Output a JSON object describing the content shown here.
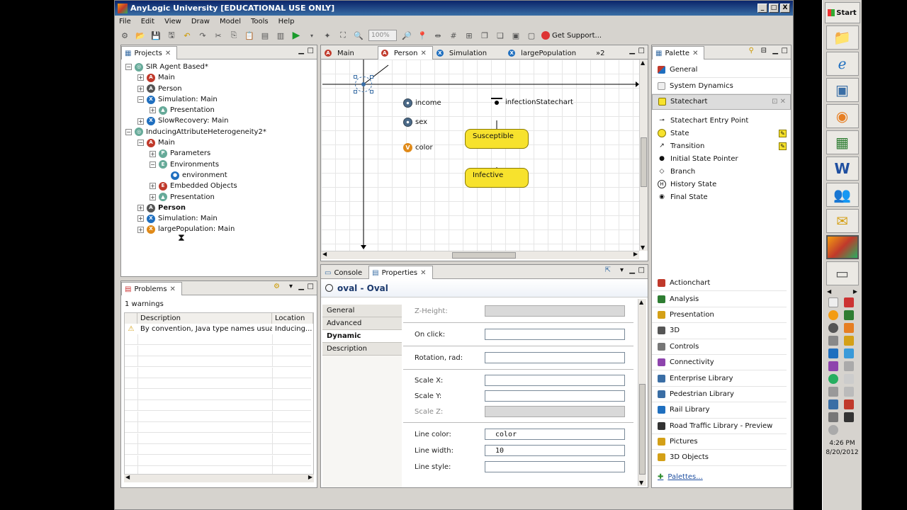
{
  "window": {
    "title": "AnyLogic University [EDUCATIONAL USE ONLY]",
    "controls": [
      "_",
      "□",
      "X"
    ]
  },
  "menu": [
    "File",
    "Edit",
    "View",
    "Draw",
    "Model",
    "Tools",
    "Help"
  ],
  "toolbar": {
    "zoom": "100%",
    "get_support": "Get Support..."
  },
  "projects": {
    "tab": "Projects",
    "tree": [
      {
        "depth": 0,
        "exp": "-",
        "icon": "project",
        "label": "SIR Agent Based*",
        "bold": false
      },
      {
        "depth": 1,
        "exp": "+",
        "icon": "agent",
        "label": "Main",
        "bold": false
      },
      {
        "depth": 1,
        "exp": "+",
        "icon": "agent-gray",
        "label": "Person",
        "bold": false
      },
      {
        "depth": 1,
        "exp": "-",
        "icon": "experiment",
        "label": "Simulation: Main",
        "bold": false
      },
      {
        "depth": 2,
        "exp": "+",
        "icon": "presentation",
        "label": "Presentation",
        "bold": false
      },
      {
        "depth": 1,
        "exp": "+",
        "icon": "experiment",
        "label": "SlowRecovery: Main",
        "bold": false
      },
      {
        "depth": 0,
        "exp": "-",
        "icon": "project",
        "label": "InducingAttributeHeterogeneity2*",
        "bold": false
      },
      {
        "depth": 1,
        "exp": "-",
        "icon": "agent",
        "label": "Main",
        "bold": false
      },
      {
        "depth": 2,
        "exp": "+",
        "icon": "parameters",
        "label": "Parameters",
        "bold": false
      },
      {
        "depth": 2,
        "exp": "-",
        "icon": "environments",
        "label": "Environments",
        "bold": false
      },
      {
        "depth": 3,
        "exp": "",
        "icon": "globe",
        "label": "environment",
        "bold": false
      },
      {
        "depth": 2,
        "exp": "+",
        "icon": "embedded",
        "label": "Embedded Objects",
        "bold": false
      },
      {
        "depth": 2,
        "exp": "+",
        "icon": "presentation",
        "label": "Presentation",
        "bold": false
      },
      {
        "depth": 1,
        "exp": "+",
        "icon": "agent-gray",
        "label": "Person",
        "bold": true
      },
      {
        "depth": 1,
        "exp": "+",
        "icon": "experiment",
        "label": "Simulation: Main",
        "bold": false
      },
      {
        "depth": 1,
        "exp": "+",
        "icon": "experiment-orange",
        "label": "largePopulation: Main",
        "bold": false
      }
    ]
  },
  "problems": {
    "tab": "Problems",
    "summary": "1 warnings",
    "columns": [
      "Description",
      "Location"
    ],
    "rows": [
      {
        "description": "By convention, Java type names usuall...",
        "location": "Inducing..."
      }
    ]
  },
  "editor": {
    "tabs": [
      {
        "label": "Main",
        "active": false
      },
      {
        "label": "Person",
        "active": true
      },
      {
        "label": "Simulation",
        "active": false
      },
      {
        "label": "largePopulation",
        "active": false
      }
    ],
    "overflow": "»2",
    "params": [
      {
        "type": "parameter",
        "label": "income"
      },
      {
        "type": "parameter",
        "label": "sex"
      },
      {
        "type": "variable",
        "label": "color"
      }
    ],
    "statechart_name": "infectionStatechart",
    "states": [
      "Susceptible",
      "Infective"
    ]
  },
  "bottom_tabs": {
    "console": "Console",
    "properties": "Properties"
  },
  "properties": {
    "title": "oval - Oval",
    "sections": [
      {
        "label": "General",
        "active": false
      },
      {
        "label": "Advanced",
        "active": false
      },
      {
        "label": "Dynamic",
        "active": true
      },
      {
        "label": "Description",
        "active": false
      }
    ],
    "fields": {
      "z_height": {
        "label": "Z-Height:",
        "value": ""
      },
      "on_click": {
        "label": "On click:",
        "value": ""
      },
      "rotation": {
        "label": "Rotation, rad:",
        "value": ""
      },
      "scale_x": {
        "label": "Scale X:",
        "value": ""
      },
      "scale_y": {
        "label": "Scale Y:",
        "value": ""
      },
      "scale_z": {
        "label": "Scale Z:",
        "value": ""
      },
      "line_color": {
        "label": "Line color:",
        "value": "color"
      },
      "line_width": {
        "label": "Line width:",
        "value": "10"
      },
      "line_style": {
        "label": "Line style:",
        "value": ""
      }
    }
  },
  "palette": {
    "tab": "Palette",
    "groups_top": [
      "General",
      "System Dynamics"
    ],
    "open_group": "Statechart",
    "statechart_items": [
      {
        "label": "Statechart Entry Point",
        "icon": "entry-point"
      },
      {
        "label": "State",
        "icon": "state"
      },
      {
        "label": "Transition",
        "icon": "transition"
      },
      {
        "label": "Initial State Pointer",
        "icon": "initial-pointer"
      },
      {
        "label": "Branch",
        "icon": "branch"
      },
      {
        "label": "History State",
        "icon": "history"
      },
      {
        "label": "Final State",
        "icon": "final"
      }
    ],
    "groups_bottom": [
      {
        "label": "Actionchart",
        "color": "#c0392b"
      },
      {
        "label": "Analysis",
        "color": "#2e7d32"
      },
      {
        "label": "Presentation",
        "color": "#d4a017"
      },
      {
        "label": "3D",
        "color": "#555555"
      },
      {
        "label": "Controls",
        "color": "#777777"
      },
      {
        "label": "Connectivity",
        "color": "#8e44ad"
      },
      {
        "label": "Enterprise Library",
        "color": "#3a6ea5"
      },
      {
        "label": "Pedestrian Library",
        "color": "#3a6ea5"
      },
      {
        "label": "Rail Library",
        "color": "#1f6fbf"
      },
      {
        "label": "Road Traffic Library - Preview",
        "color": "#333333"
      },
      {
        "label": "Pictures",
        "color": "#d4a017"
      },
      {
        "label": "3D Objects",
        "color": "#d4a017"
      }
    ],
    "footer": "Palettes..."
  },
  "taskbar": {
    "start": "Start",
    "time": "4:26 PM",
    "date": "8/20/2012"
  },
  "colors": {
    "accent": "#0a246a",
    "state_fill": "#f7e22d",
    "title_text": "#1c3a6e"
  }
}
